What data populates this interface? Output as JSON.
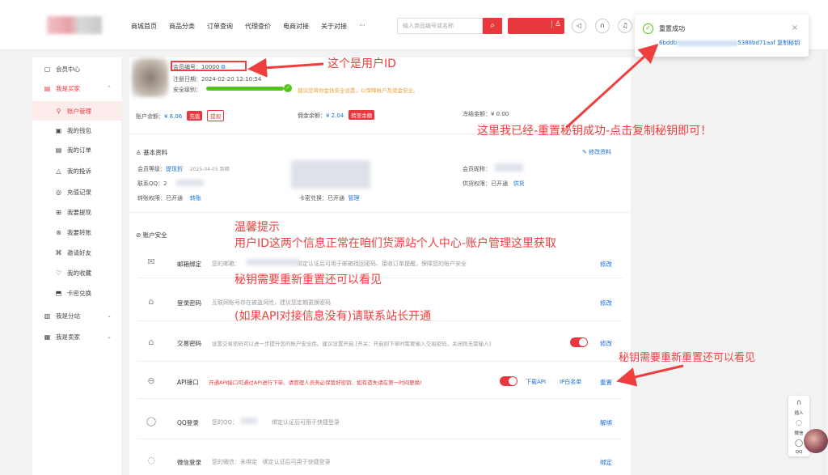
{
  "header": {
    "nav": [
      "商城首页",
      "商品分类",
      "订单查询",
      "代理查价",
      "电商对接",
      "关于对接",
      "···"
    ],
    "search_placeholder": "输入商品编号或名称",
    "search_icon": "search-icon",
    "icons": [
      "volume-icon",
      "headset-icon",
      "bell-icon"
    ]
  },
  "toast": {
    "title": "重置成功",
    "key_prefix": "6bddb",
    "key_suffix": "5388bd71aaf",
    "copy_label": "复制秘钥",
    "close": "×"
  },
  "sidebar": {
    "items": [
      {
        "label": "会员中心",
        "icon": "▢"
      },
      {
        "label": "我是买家",
        "icon": "▤",
        "arrow": "⌃"
      },
      {
        "label": "账户管理",
        "icon": "⚲"
      },
      {
        "label": "我的钱包",
        "icon": "▣"
      },
      {
        "label": "我的订单",
        "icon": "▤"
      },
      {
        "label": "我的投诉",
        "icon": "△"
      },
      {
        "label": "充值记录",
        "icon": "◎"
      },
      {
        "label": "我要提现",
        "icon": "⊞"
      },
      {
        "label": "我要转账",
        "icon": "⊛"
      },
      {
        "label": "邀请好友",
        "icon": "⌘"
      },
      {
        "label": "我的收藏",
        "icon": "♡"
      },
      {
        "label": "卡密兑换",
        "icon": "⬒"
      },
      {
        "label": "我是分站",
        "icon": "▥",
        "arrow": "⌄"
      },
      {
        "label": "我是卖家",
        "icon": "▦",
        "arrow": "⌄"
      }
    ]
  },
  "profile": {
    "member_id_label": "会员编号：",
    "member_id": "10000",
    "reg_date_label": "注册日期：",
    "reg_date": "2024-02-20 12:10:54",
    "security_label": "安全级别：",
    "security_level": 1.0,
    "security_tip": "建议您将你金钱安全设置，以保障账户及资金安全。"
  },
  "balances": [
    {
      "label": "账户余额：",
      "value": "¥ 8.06",
      "btn1": "充值",
      "btn2": "提现"
    },
    {
      "label": "佣金余额：",
      "value": "¥ 2.04",
      "btn1": "转至余额"
    },
    {
      "label": "冻结金额：",
      "value": "¥ 0.00"
    }
  ],
  "basic": {
    "title": "基本资料",
    "edit": "修改资料",
    "level_label": "会员等级：",
    "level_value": "提现折",
    "level_expire": "2025-04-05 到期",
    "qq_label": "联系QQ：",
    "qq_value": "2",
    "transfer_label": "转账权限：",
    "transfer_value": "已开通",
    "transfer_action": "转账",
    "card_label": "卡密兑换：",
    "card_value": "已开通",
    "card_action": "管理",
    "nickname_label": "会员昵称：",
    "supply_label": "供货权限：",
    "supply_value": "已开通",
    "supply_action": "供货"
  },
  "security": {
    "title": "账户安全",
    "rows": [
      {
        "icon": "mail-icon",
        "glyph": "✉",
        "title": "邮箱绑定",
        "desc": "您的邮箱：",
        "desc2": "绑定认证后可用于邮箱找回密码、接收订单提醒，保障您的账户安全",
        "action": "修改"
      },
      {
        "icon": "lock-icon",
        "glyph": "🔒",
        "title": "登录密码",
        "desc": "互联网账号存在被盗风险，建议您定期更换密码",
        "action": "修改"
      },
      {
        "icon": "lock-icon",
        "glyph": "🔒",
        "title": "交易密码",
        "desc": "设置交易密码可以进一步提升您的账户安全性。建议设置开启 [开关：开启则下单时需要输入交易密码，关闭则无需输入]",
        "action": "修改"
      },
      {
        "icon": "api-icon",
        "glyph": "⊖",
        "title": "API接口",
        "desc": "开通API接口可通过API进行下单、请管理人员务必保管好密钥、如有遗失请在第一时间更换!",
        "actions": [
          "下载API",
          "IP白名单",
          "重置"
        ]
      },
      {
        "icon": "qq-icon",
        "glyph": "◯",
        "title": "QQ登录",
        "desc": "您的QQ：",
        "desc2": "绑定认证后可用于快捷登录",
        "action": "解绑"
      },
      {
        "icon": "wechat-icon",
        "glyph": "◌",
        "title": "微信登录",
        "desc": "您的微信：未绑定",
        "desc2": "绑定认证后可用于快捷登录",
        "action": "绑定"
      }
    ]
  },
  "annotations": {
    "user_id": "这个是用户ID",
    "reset_done": "这里我已经-重置秘钥成功-点击复制秘钥即可！",
    "tip_title": "温馨提示",
    "tip_line1": "用户ID这两个信息正常在咱们货源站个人中心-账户管理这里获取",
    "tip_line2": "秘钥需要重新重置还可以看见",
    "tip_line3": "(如果API对接信息没有)请联系站长开通",
    "reset_again": "秘钥需要重新重置还可以看见"
  },
  "float": {
    "items": [
      "插入",
      "微信",
      "QQ"
    ]
  },
  "colors": {
    "accent": "#e8383d",
    "link": "#1a6fd8",
    "success": "#52c41a",
    "annotation": "#ef3e3e"
  }
}
